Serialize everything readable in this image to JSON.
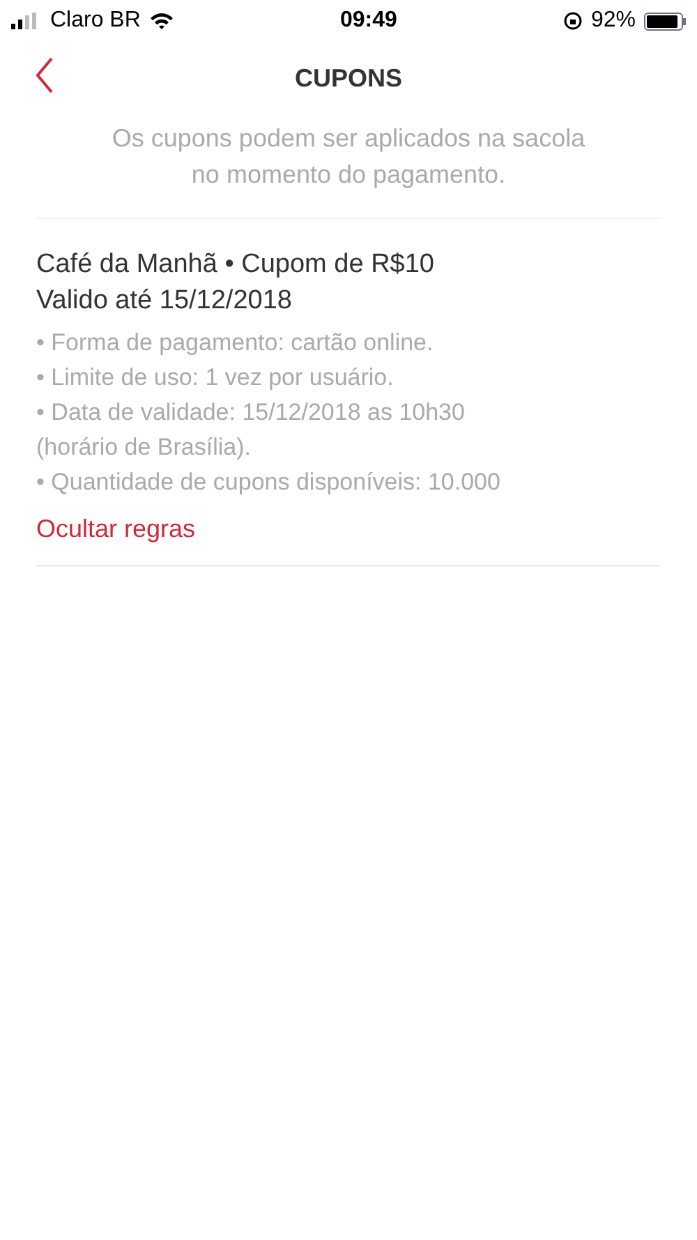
{
  "status_bar": {
    "carrier": "Claro BR",
    "time": "09:49",
    "battery": "92%"
  },
  "header": {
    "title": "CUPONS"
  },
  "intro": "Os cupons podem ser aplicados na sacola no momento do pagamento.",
  "coupons": [
    {
      "title": "Café da Manhã • Cupom de R$10",
      "validity": "Valido até 15/12/2018",
      "rule_lines": [
        "• Forma de pagamento: cartão online.",
        "• Limite de uso: 1 vez por usuário.",
        "• Data de validade: 15/12/2018 as 10h30",
        "(horário de Brasília).",
        "• Quantidade de cupons disponíveis: 10.000"
      ],
      "toggle_label": "Ocultar regras"
    }
  ]
}
